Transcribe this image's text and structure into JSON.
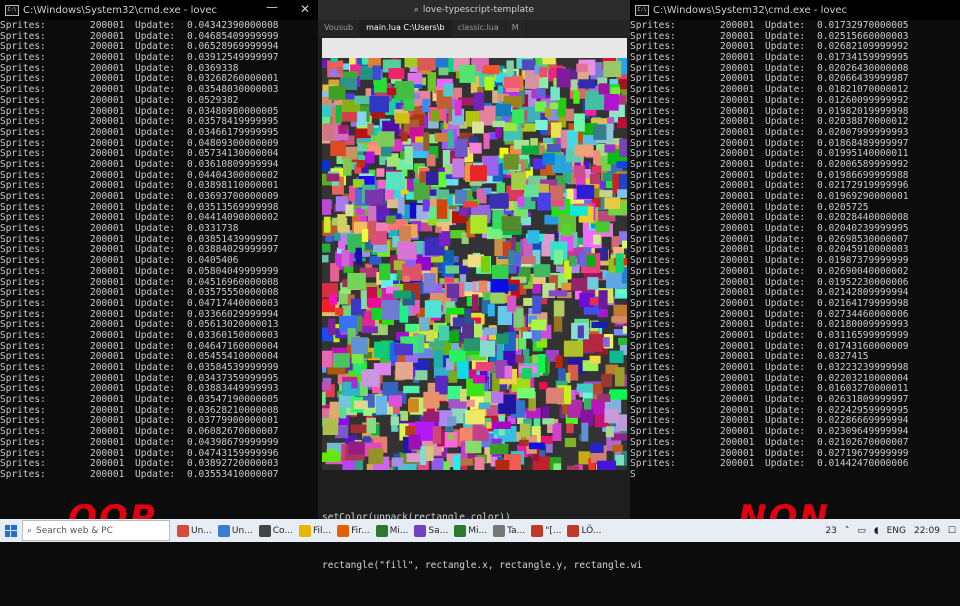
{
  "left_console": {
    "title": "C:\\Windows\\System32\\cmd.exe - lovec",
    "rows": [
      {
        "label": "Sprites:",
        "count": "200001",
        "key": "Update:",
        "value": "0.04342390000008"
      },
      {
        "label": "Sprites:",
        "count": "200001",
        "key": "Update:",
        "value": "0.04685409999999"
      },
      {
        "label": "Sprites:",
        "count": "200001",
        "key": "Update:",
        "value": "0.06528969999994"
      },
      {
        "label": "Sprites:",
        "count": "200001",
        "key": "Update:",
        "value": "0.03912549999997"
      },
      {
        "label": "Sprites:",
        "count": "200001",
        "key": "Update:",
        "value": "0.0369338"
      },
      {
        "label": "Sprites:",
        "count": "200001",
        "key": "Update:",
        "value": "0.03268260000001"
      },
      {
        "label": "Sprites:",
        "count": "200001",
        "key": "Update:",
        "value": "0.03548030000003"
      },
      {
        "label": "Sprites:",
        "count": "200001",
        "key": "Update:",
        "value": "0.0529382"
      },
      {
        "label": "Sprites:",
        "count": "200001",
        "key": "Update:",
        "value": "0.03480980000005"
      },
      {
        "label": "Sprites:",
        "count": "200001",
        "key": "Update:",
        "value": "0.03578419999995"
      },
      {
        "label": "Sprites:",
        "count": "200001",
        "key": "Update:",
        "value": "0.03466179999995"
      },
      {
        "label": "Sprites:",
        "count": "200001",
        "key": "Update:",
        "value": "0.04809300000009"
      },
      {
        "label": "Sprites:",
        "count": "200001",
        "key": "Update:",
        "value": "0.05734130000004"
      },
      {
        "label": "Sprites:",
        "count": "200001",
        "key": "Update:",
        "value": "0.03610809999994"
      },
      {
        "label": "Sprites:",
        "count": "200001",
        "key": "Update:",
        "value": "0.04404300000002"
      },
      {
        "label": "Sprites:",
        "count": "200001",
        "key": "Update:",
        "value": "0.03898110000001"
      },
      {
        "label": "Sprites:",
        "count": "200001",
        "key": "Update:",
        "value": "0.03693700000009"
      },
      {
        "label": "Sprites:",
        "count": "200001",
        "key": "Update:",
        "value": "0.03513569999998"
      },
      {
        "label": "Sprites:",
        "count": "200001",
        "key": "Update:",
        "value": "0.04414090000002"
      },
      {
        "label": "Sprites:",
        "count": "200001",
        "key": "Update:",
        "value": "0.0331738"
      },
      {
        "label": "Sprites:",
        "count": "200001",
        "key": "Update:",
        "value": "0.03851439999997"
      },
      {
        "label": "Sprites:",
        "count": "200001",
        "key": "Update:",
        "value": "0.03884029999997"
      },
      {
        "label": "Sprites:",
        "count": "200001",
        "key": "Update:",
        "value": "0.0405406"
      },
      {
        "label": "Sprites:",
        "count": "200001",
        "key": "Update:",
        "value": "0.05804049999999"
      },
      {
        "label": "Sprites:",
        "count": "200001",
        "key": "Update:",
        "value": "0.04516960000008"
      },
      {
        "label": "Sprites:",
        "count": "200001",
        "key": "Update:",
        "value": "0.03575550000008"
      },
      {
        "label": "Sprites:",
        "count": "200001",
        "key": "Update:",
        "value": "0.04717440000003"
      },
      {
        "label": "Sprites:",
        "count": "200001",
        "key": "Update:",
        "value": "0.03366029999994"
      },
      {
        "label": "Sprites:",
        "count": "200001",
        "key": "Update:",
        "value": "0.05613020000013"
      },
      {
        "label": "Sprites:",
        "count": "200001",
        "key": "Update:",
        "value": "0.03360150000003"
      },
      {
        "label": "Sprites:",
        "count": "200001",
        "key": "Update:",
        "value": "0.04647160000004"
      },
      {
        "label": "Sprites:",
        "count": "200001",
        "key": "Update:",
        "value": "0.05455410000004"
      },
      {
        "label": "Sprites:",
        "count": "200001",
        "key": "Update:",
        "value": "0.03584539999999"
      },
      {
        "label": "Sprites:",
        "count": "200001",
        "key": "Update:",
        "value": "0.03437359999995"
      },
      {
        "label": "Sprites:",
        "count": "200001",
        "key": "Update:",
        "value": "0.03883449999993"
      },
      {
        "label": "Sprites:",
        "count": "200001",
        "key": "Update:",
        "value": "0.03547190000005"
      },
      {
        "label": "Sprites:",
        "count": "200001",
        "key": "Update:",
        "value": "0.03628210000008"
      },
      {
        "label": "Sprites:",
        "count": "200001",
        "key": "Update:",
        "value": "0.03779900000001"
      },
      {
        "label": "Sprites:",
        "count": "200001",
        "key": "Update:",
        "value": "0.06082670000007"
      },
      {
        "label": "Sprites:",
        "count": "200001",
        "key": "Update:",
        "value": "0.04398679999999"
      },
      {
        "label": "Sprites:",
        "count": "200001",
        "key": "Update:",
        "value": "0.04743159999996"
      },
      {
        "label": "Sprites:",
        "count": "200001",
        "key": "Update:",
        "value": "0.03892720000003"
      },
      {
        "label": "Sprites:",
        "count": "200001",
        "key": "Update:",
        "value": "0.03553410000007"
      }
    ]
  },
  "right_console": {
    "title": "C:\\Windows\\System32\\cmd.exe - lovec",
    "rows": [
      {
        "label": "Sprites:",
        "count": "200001",
        "key": "Update:",
        "value": "0.01732970000005"
      },
      {
        "label": "Sprites:",
        "count": "200001",
        "key": "Update:",
        "value": "0.02515660000003"
      },
      {
        "label": "Sprites:",
        "count": "200001",
        "key": "Update:",
        "value": "0.02682109999992"
      },
      {
        "label": "Sprites:",
        "count": "200001",
        "key": "Update:",
        "value": "0.01734159999995"
      },
      {
        "label": "Sprites:",
        "count": "200001",
        "key": "Update:",
        "value": "0.02026430000008"
      },
      {
        "label": "Sprites:",
        "count": "200001",
        "key": "Update:",
        "value": "0.02066439999987"
      },
      {
        "label": "Sprites:",
        "count": "200001",
        "key": "Update:",
        "value": "0.01821070000012"
      },
      {
        "label": "Sprites:",
        "count": "200001",
        "key": "Update:",
        "value": "0.01260099999992"
      },
      {
        "label": "Sprites:",
        "count": "200001",
        "key": "Update:",
        "value": "0.01982019999998"
      },
      {
        "label": "Sprites:",
        "count": "200001",
        "key": "Update:",
        "value": "0.02038870000012"
      },
      {
        "label": "Sprites:",
        "count": "200001",
        "key": "Update:",
        "value": "0.02007999999993"
      },
      {
        "label": "Sprites:",
        "count": "200001",
        "key": "Update:",
        "value": "0.01868489999997"
      },
      {
        "label": "Sprites:",
        "count": "200001",
        "key": "Update:",
        "value": "0.01995140000011"
      },
      {
        "label": "Sprites:",
        "count": "200001",
        "key": "Update:",
        "value": "0.02006589999992"
      },
      {
        "label": "Sprites:",
        "count": "200001",
        "key": "Update:",
        "value": "0.01986699999988"
      },
      {
        "label": "Sprites:",
        "count": "200001",
        "key": "Update:",
        "value": "0.02172919999996"
      },
      {
        "label": "Sprites:",
        "count": "200001",
        "key": "Update:",
        "value": "0.01969290000001"
      },
      {
        "label": "Sprites:",
        "count": "200001",
        "key": "Update:",
        "value": "0.0205725"
      },
      {
        "label": "Sprites:",
        "count": "200001",
        "key": "Update:",
        "value": "0.02028440000008"
      },
      {
        "label": "Sprites:",
        "count": "200001",
        "key": "Update:",
        "value": "0.02040239999995"
      },
      {
        "label": "Sprites:",
        "count": "200001",
        "key": "Update:",
        "value": "0.02698530000007"
      },
      {
        "label": "Sprites:",
        "count": "200001",
        "key": "Update:",
        "value": "0.02045910000003"
      },
      {
        "label": "Sprites:",
        "count": "200001",
        "key": "Update:",
        "value": "0.01987379999999"
      },
      {
        "label": "Sprites:",
        "count": "200001",
        "key": "Update:",
        "value": "0.02690040000002"
      },
      {
        "label": "Sprites:",
        "count": "200001",
        "key": "Update:",
        "value": "0.01952230000006"
      },
      {
        "label": "Sprites:",
        "count": "200001",
        "key": "Update:",
        "value": "0.02142809999994"
      },
      {
        "label": "Sprites:",
        "count": "200001",
        "key": "Update:",
        "value": "0.02164179999998"
      },
      {
        "label": "Sprites:",
        "count": "200001",
        "key": "Update:",
        "value": "0.02734460000006"
      },
      {
        "label": "Sprites:",
        "count": "200001",
        "key": "Update:",
        "value": "0.02180009999993"
      },
      {
        "label": "Sprites:",
        "count": "200001",
        "key": "Update:",
        "value": "0.03116599999999"
      },
      {
        "label": "Sprites:",
        "count": "200001",
        "key": "Update:",
        "value": "0.01743160000009"
      },
      {
        "label": "Sprites:",
        "count": "200001",
        "key": "Update:",
        "value": "0.0327415"
      },
      {
        "label": "Sprites:",
        "count": "200001",
        "key": "Update:",
        "value": "0.03223239999998"
      },
      {
        "label": "Sprites:",
        "count": "200001",
        "key": "Update:",
        "value": "0.02203210000004"
      },
      {
        "label": "Sprites:",
        "count": "200001",
        "key": "Update:",
        "value": "0.01603270000011"
      },
      {
        "label": "Sprites:",
        "count": "200001",
        "key": "Update:",
        "value": "0.02631809999997"
      },
      {
        "label": "Sprites:",
        "count": "200001",
        "key": "Update:",
        "value": "0.02242959999995"
      },
      {
        "label": "Sprites:",
        "count": "200001",
        "key": "Update:",
        "value": "0.02286669999994"
      },
      {
        "label": "Sprites:",
        "count": "200001",
        "key": "Update:",
        "value": "0.02309649999994"
      },
      {
        "label": "Sprites:",
        "count": "200001",
        "key": "Update:",
        "value": "0.02102670000007"
      },
      {
        "label": "Sprites:",
        "count": "200001",
        "key": "Update:",
        "value": "0.02719679999999"
      },
      {
        "label": "Sprites:",
        "count": "200001",
        "key": "Update:",
        "value": "0.01442470000006"
      }
    ],
    "last_char": "S"
  },
  "editor": {
    "window_title": "love-typescript-template",
    "tabs": [
      "Vousub",
      "main.lua C:\\Users\\b",
      "classic.lua",
      "M"
    ],
    "code_line1": "setColor(unpack(rectangle.color))",
    "code_line2": "rectangle(\"fill\", rectangle.x, rectangle.y, rectangle.wi"
  },
  "annotations": {
    "left": "OOP",
    "right": "NON"
  },
  "taskbar": {
    "search_placeholder": "Search web & PC",
    "items": [
      "Un...",
      "Un...",
      "Co...",
      "Fil...",
      "Fir...",
      "Mi...",
      "Sa...",
      "Mi...",
      "Ta...",
      "\"[...",
      "LÖ..."
    ],
    "language": "ENG",
    "time": "22:09",
    "notification_count": "23"
  },
  "colors": {
    "annotation": "#e10010",
    "console_bg": "#0c0c0c",
    "console_text": "#cccccc"
  }
}
